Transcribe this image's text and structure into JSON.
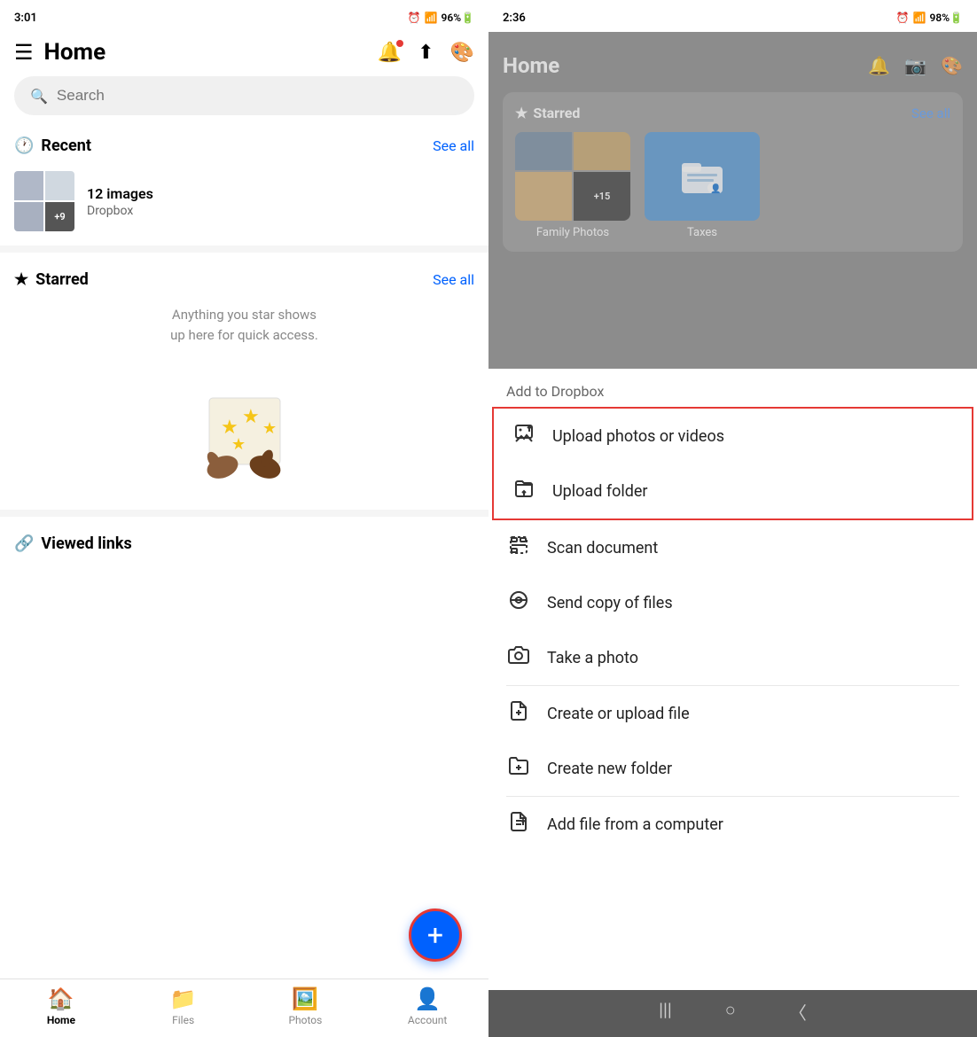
{
  "left": {
    "status_time": "3:01",
    "header_title": "Home",
    "search_placeholder": "Search",
    "recent_label": "Recent",
    "see_all_recent": "See all",
    "recent_item": {
      "count": "12 images",
      "source": "Dropbox",
      "extra": "+9"
    },
    "starred_label": "Starred",
    "see_all_starred": "See all",
    "starred_empty": "Anything you star shows\nup here for quick access.",
    "viewed_links_label": "Viewed links",
    "nav_items": [
      {
        "label": "Home",
        "active": true
      },
      {
        "label": "Files",
        "active": false
      },
      {
        "label": "Photos",
        "active": false
      },
      {
        "label": "Account",
        "active": false
      }
    ]
  },
  "right": {
    "status_time": "2:36",
    "home_title": "Home",
    "starred_label": "Starred",
    "see_all_label": "See all",
    "family_photos_label": "Family Photos",
    "taxes_label": "Taxes",
    "photo_extra": "+15",
    "add_to_dropbox_label": "Add to Dropbox",
    "menu_items": [
      {
        "id": "upload-photos",
        "text": "Upload photos or videos",
        "icon": "photo-upload",
        "highlighted": true
      },
      {
        "id": "upload-folder",
        "text": "Upload folder",
        "icon": "folder-upload",
        "highlighted": true
      },
      {
        "id": "scan-document",
        "text": "Scan document",
        "icon": "scan",
        "highlighted": false
      },
      {
        "id": "send-copy",
        "text": "Send copy of files",
        "icon": "send-copy",
        "highlighted": false
      },
      {
        "id": "take-photo",
        "text": "Take a photo",
        "icon": "camera",
        "highlighted": false
      },
      {
        "id": "create-upload-file",
        "text": "Create or upload file",
        "icon": "create-file",
        "highlighted": false
      },
      {
        "id": "create-folder",
        "text": "Create new folder",
        "icon": "create-folder",
        "highlighted": false
      },
      {
        "id": "add-from-computer",
        "text": "Add file from a computer",
        "icon": "computer-add",
        "highlighted": false
      }
    ]
  }
}
